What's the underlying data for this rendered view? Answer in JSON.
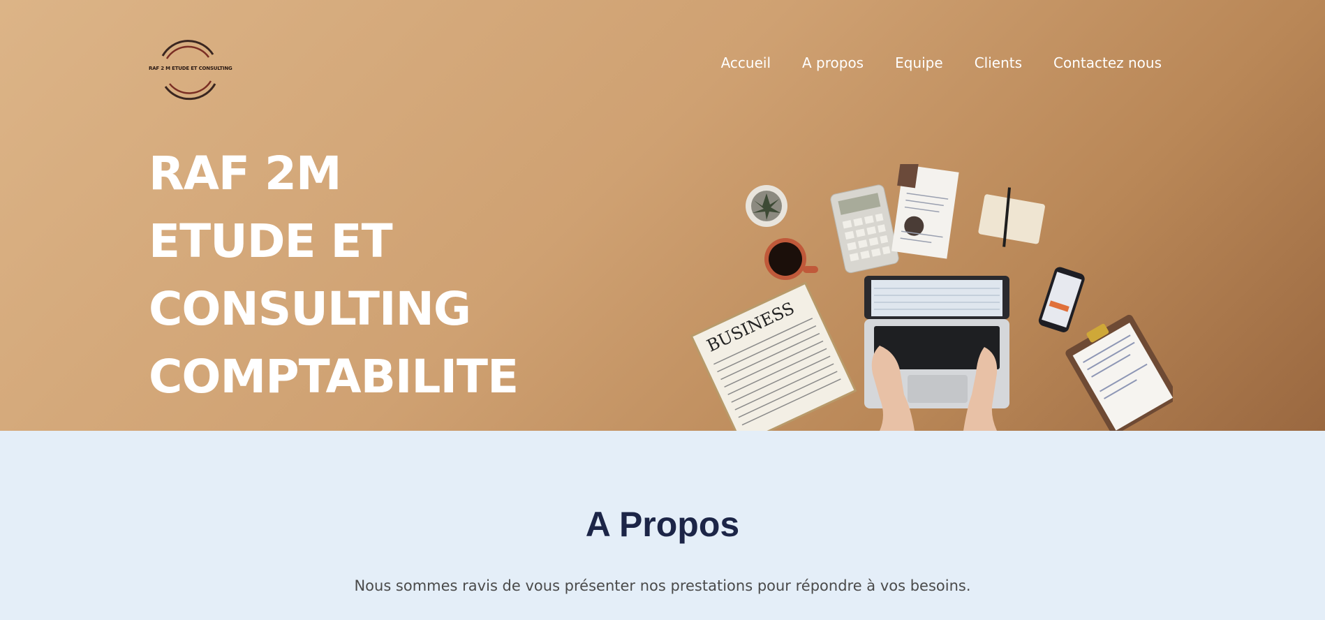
{
  "brand": {
    "logo_text": "RAF 2 M ETUDE ET CONSULTING"
  },
  "nav": {
    "items": [
      {
        "label": "Accueil"
      },
      {
        "label": "A propos"
      },
      {
        "label": "Equipe"
      },
      {
        "label": "Clients"
      },
      {
        "label": "Contactez nous"
      }
    ]
  },
  "hero": {
    "lines": [
      "RAF 2M",
      "ETUDE ET",
      "CONSULTING",
      "COMPTABILITE"
    ],
    "image_icon": "desk-workspace-illustration",
    "newspaper_text": "BUSINESS"
  },
  "about": {
    "title": "A Propos",
    "text": "Nous sommes ravis de vous présenter nos prestations pour répondre à vos besoins."
  },
  "colors": {
    "hero_bg": "#cfa172",
    "about_bg": "#e4eef8",
    "heading": "#1c2547",
    "logo_dark": "#4a1f1a"
  }
}
